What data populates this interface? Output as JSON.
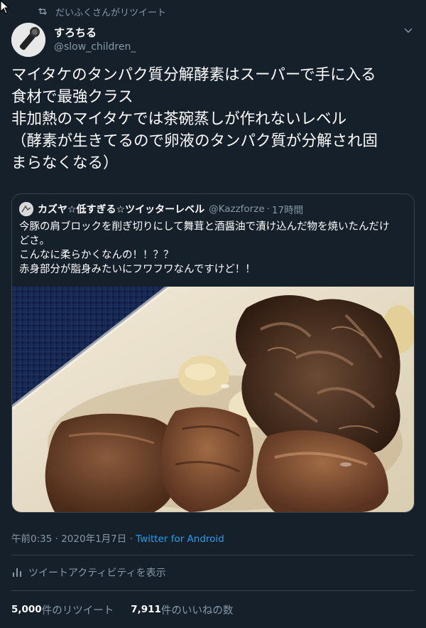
{
  "retweeted_by": "だいふくさんがリツイート",
  "author": {
    "name": "すろちる",
    "handle": "@slow_children_"
  },
  "tweet_lines": [
    "マイタケのタンパク質分解酵素はスーパーで手に入る",
    "食材で最強クラス",
    "非加熱のマイタケでは茶碗蒸しが作れないレベル",
    "（酵素が生きてるので卵液のタンパク質が分解され固",
    "まらなくなる）"
  ],
  "quote": {
    "name": "カズヤ☆低すぎる☆ツイッターレベル",
    "handle": "@Kazzforze",
    "separator": "·",
    "time": "17時間",
    "lines": [
      "今豚の肩ブロックを削ぎ切りにして舞茸と酒醤油で漬け込んだ物を焼いたんだけ",
      "どさ。",
      "こんなに柔らかくなんの！！？？",
      "赤身部分が脂身みたいにフワフワなんですけど！！"
    ]
  },
  "meta": {
    "time": "午前0:35",
    "separator": "·",
    "date": "2020年1月7日",
    "source": "Twitter for Android"
  },
  "activity_label": "ツイートアクティビティを表示",
  "stats": {
    "retweet_count": "5,000",
    "retweet_label": "件のリツイート",
    "like_count": "7,911",
    "like_label": "件のいいねの数"
  },
  "colors": {
    "background": "#15202b",
    "secondary_text": "#8899a6",
    "link": "#1da1f2",
    "border": "#38444d"
  },
  "icons": {
    "cursor": "mouse-pointer-icon",
    "retweet": "retweet-icon",
    "caret": "chevron-down-icon",
    "activity": "bar-chart-icon"
  }
}
